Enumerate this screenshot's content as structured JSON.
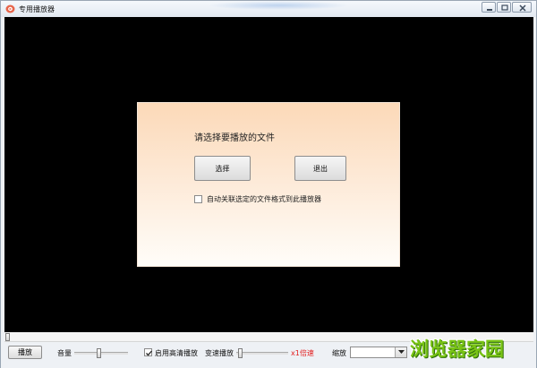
{
  "window": {
    "title": "专用播放器",
    "icon": "media-player-app-icon"
  },
  "dialog": {
    "prompt": "请选择要播放的文件",
    "select_label": "选择",
    "exit_label": "退出",
    "associate_label": "自动关联选定的文件格式到此播放器",
    "associate_checked": false
  },
  "controls": {
    "seek_progress": 0,
    "play_label": "播放",
    "volume_label": "音量",
    "volume_level": 0.45,
    "hd_label": "启用高清播放",
    "hd_checked": true,
    "speed_label": "变速播放",
    "speed_level": 0.03,
    "speed_value": "x1倍速",
    "zoom_label": "缩放",
    "zoom_value": ""
  },
  "watermark": "浏览器家园",
  "colors": {
    "video_bg": "#000000",
    "speed_text": "#e21e1e",
    "watermark": "#79c415",
    "dialog_top": "#fcd9b8"
  }
}
